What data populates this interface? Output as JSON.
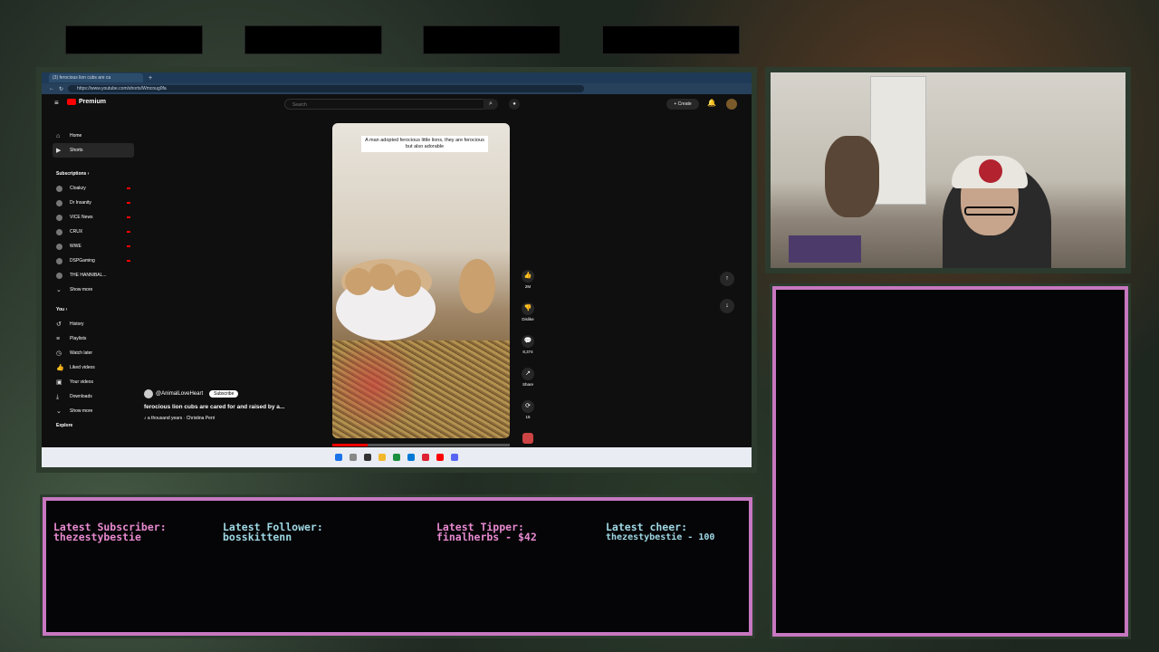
{
  "browser": {
    "tab_title": "(3) ferocious lion cubs are ca",
    "url": "https://www.youtube.com/shorts/Wmcnug0fa"
  },
  "youtube": {
    "logo_text": "Premium",
    "search_placeholder": "Search",
    "create_label": "Create",
    "notif_count": "9+"
  },
  "sidebar": {
    "main": [
      {
        "label": "Home",
        "icon": "home-icon"
      },
      {
        "label": "Shorts",
        "icon": "shorts-icon"
      }
    ],
    "subscriptions_header": "Subscriptions",
    "subscriptions": [
      "Cloakzy",
      "Dr Insanity",
      "VICE News",
      "CRUX",
      "WWE",
      "DSPGaming",
      "THE HANNIBAL..."
    ],
    "show_more": "Show more",
    "you_header": "You",
    "you": [
      "History",
      "Playlists",
      "Watch later",
      "Liked videos",
      "Your videos",
      "Downloads"
    ],
    "explore_header": "Explore"
  },
  "short": {
    "caption": "A man adopted ferocious little lions, they are ferocious but also adorable",
    "channel": "@AnimalLoveHeart",
    "subscribe_label": "Subscribe",
    "title": "ferocious lion cubs are cared for and raised by a...",
    "music": "♪ a thousand years · Christina Perri",
    "likes": "2M",
    "dislike_label": "Dislike",
    "comments": "8,374",
    "share_label": "Share",
    "remix_count": "15",
    "progress_fraction": 0.2
  },
  "overlay": {
    "latest_subscriber_label": "Latest Subscriber:",
    "latest_subscriber_value": "thezestybestie",
    "latest_follower_label": "Latest Follower:",
    "latest_follower_value": "bosskittenn",
    "latest_tipper_label": "Latest Tipper:",
    "latest_tipper_value": "finalherbs - $42",
    "latest_cheer_label": "Latest cheer:",
    "latest_cheer_value": "thezestybestie - 100"
  },
  "colors": {
    "overlay_border": "#c777c0",
    "label_pink": "#e88ad0",
    "value_cyan": "#9fd8e4",
    "yt_red": "#ff0000"
  }
}
